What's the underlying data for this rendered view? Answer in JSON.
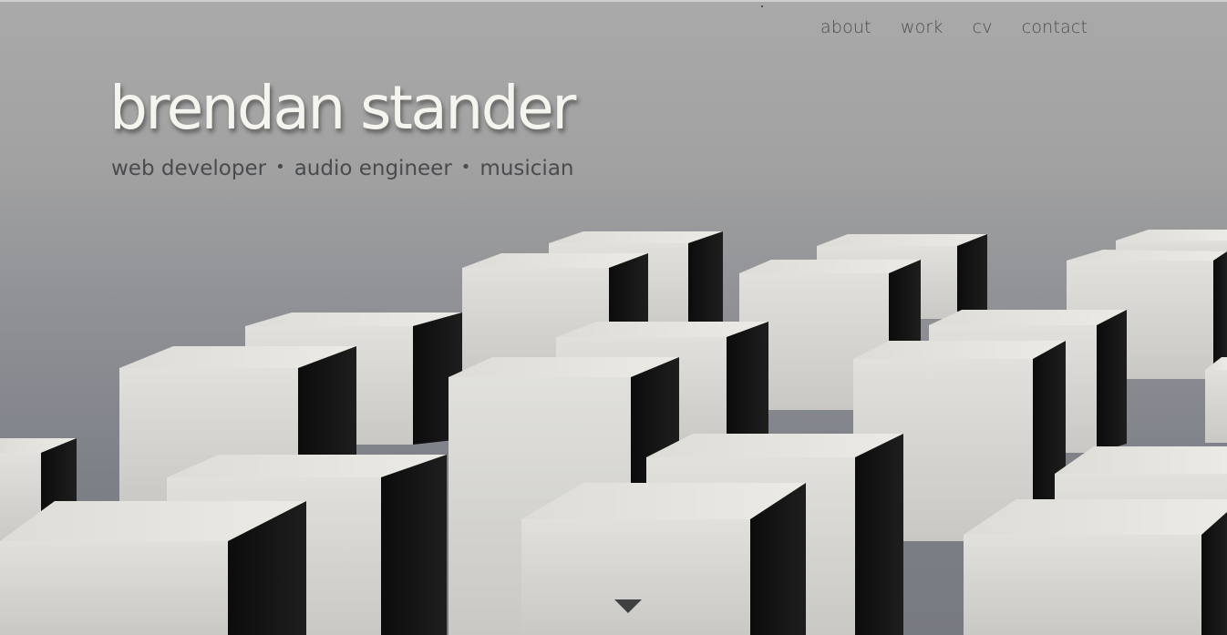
{
  "nav": {
    "items": [
      {
        "label": "about"
      },
      {
        "label": "work"
      },
      {
        "label": "cv"
      },
      {
        "label": "contact"
      }
    ]
  },
  "hero": {
    "title": "brendan stander",
    "roles": [
      "web developer",
      "audio engineer",
      "musician"
    ],
    "separator": "•",
    "scroll_icon": "triangle-down-icon"
  },
  "colors": {
    "background_top": "#a9a9a9",
    "background_bottom": "#777a80",
    "title": "#f6f4ee",
    "subtitle": "#4a4b4e",
    "nav": "#4c4c4c",
    "block_face": "#d8d7d3",
    "block_top": "#e4e3de",
    "block_side": "#151515"
  }
}
